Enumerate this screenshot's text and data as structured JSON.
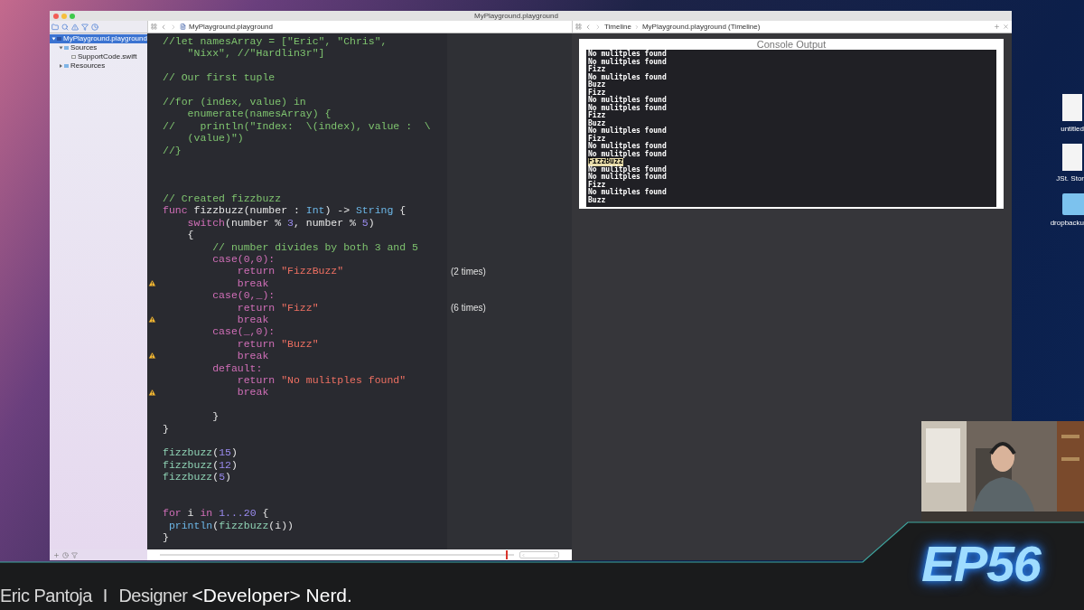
{
  "window": {
    "title": "MyPlayground.playground"
  },
  "navigator": {
    "items": [
      {
        "label": "MyPlayground.playground",
        "selected": true,
        "expanded": true,
        "children": [
          {
            "label": "Sources",
            "selected": false,
            "expanded": true,
            "children": [
              {
                "label": "SupportCode.swift",
                "selected": false
              }
            ]
          },
          {
            "label": "Resources",
            "selected": false,
            "expanded": false
          }
        ]
      }
    ]
  },
  "editor": {
    "jump_bar": "MyPlayground.playground",
    "lines": [
      {
        "warning": false,
        "tokens": [
          {
            "kind": "comment",
            "text": "//let namesArray = [\"Eric\", \"Chris\","
          }
        ]
      },
      {
        "warning": false,
        "tokens": [
          {
            "kind": "comment",
            "text": "    \"Nixx\", //\"Hardlin3r\"]"
          }
        ]
      },
      {
        "warning": false
      },
      {
        "warning": false,
        "tokens": [
          {
            "kind": "comment",
            "text": "// Our first tuple"
          }
        ]
      },
      {
        "warning": false
      },
      {
        "warning": false,
        "tokens": [
          {
            "kind": "comment",
            "text": "//for (index, value) in"
          }
        ]
      },
      {
        "warning": false,
        "tokens": [
          {
            "kind": "comment",
            "text": "    enumerate(namesArray) {"
          }
        ]
      },
      {
        "warning": false,
        "tokens": [
          {
            "kind": "comment",
            "text": "//    println(\"Index:  \\(index), value :  \\"
          }
        ]
      },
      {
        "warning": false,
        "tokens": [
          {
            "kind": "comment",
            "text": "    (value)\")"
          }
        ]
      },
      {
        "warning": false,
        "tokens": [
          {
            "kind": "comment",
            "text": "//}"
          }
        ]
      },
      {
        "warning": false
      },
      {
        "warning": false
      },
      {
        "warning": false
      },
      {
        "warning": false,
        "tokens": [
          {
            "kind": "comment",
            "text": "// Created fizzbuzz"
          }
        ]
      },
      {
        "warning": false,
        "tokens": [
          {
            "kind": "keyword",
            "text": "func"
          },
          {
            "kind": "plain",
            "text": " fizzbuzz(number : "
          },
          {
            "kind": "type",
            "text": "Int"
          },
          {
            "kind": "plain",
            "text": ") -> "
          },
          {
            "kind": "type",
            "text": "String"
          },
          {
            "kind": "plain",
            "text": " {"
          }
        ]
      },
      {
        "warning": false,
        "tokens": [
          {
            "kind": "keyword",
            "text": "    switch"
          },
          {
            "kind": "plain",
            "text": "(number % "
          },
          {
            "kind": "number",
            "text": "3"
          },
          {
            "kind": "plain",
            "text": ", number % "
          },
          {
            "kind": "number",
            "text": "5"
          },
          {
            "kind": "plain",
            "text": ")"
          }
        ]
      },
      {
        "warning": false,
        "tokens": [
          {
            "kind": "plain",
            "text": "    {"
          }
        ]
      },
      {
        "warning": false,
        "tokens": [
          {
            "kind": "comment",
            "text": "        // number divides by both 3 and 5"
          }
        ]
      },
      {
        "warning": false,
        "tokens": [
          {
            "kind": "keyword",
            "text": "        case(0,0):"
          }
        ]
      },
      {
        "warning": false,
        "result": "(2 times)",
        "tokens": [
          {
            "kind": "keyword",
            "text": "            return"
          },
          {
            "kind": "string",
            "text": " \"FizzBuzz\""
          }
        ]
      },
      {
        "warning": true,
        "tokens": [
          {
            "kind": "keyword",
            "text": "            break"
          }
        ]
      },
      {
        "warning": false,
        "tokens": [
          {
            "kind": "keyword",
            "text": "        case(0,_):"
          }
        ]
      },
      {
        "warning": false,
        "result": "(6 times)",
        "tokens": [
          {
            "kind": "keyword",
            "text": "            return"
          },
          {
            "kind": "string",
            "text": " \"Fizz\""
          }
        ]
      },
      {
        "warning": true,
        "tokens": [
          {
            "kind": "keyword",
            "text": "            break"
          }
        ]
      },
      {
        "warning": false,
        "tokens": [
          {
            "kind": "keyword",
            "text": "        case(_,0):"
          }
        ]
      },
      {
        "warning": false,
        "tokens": [
          {
            "kind": "keyword",
            "text": "            return"
          },
          {
            "kind": "string",
            "text": " \"Buzz\""
          }
        ]
      },
      {
        "warning": true,
        "tokens": [
          {
            "kind": "keyword",
            "text": "            break"
          }
        ]
      },
      {
        "warning": false,
        "tokens": [
          {
            "kind": "keyword",
            "text": "        default:"
          }
        ]
      },
      {
        "warning": false,
        "tokens": [
          {
            "kind": "keyword",
            "text": "            return"
          },
          {
            "kind": "string",
            "text": " \"No mulitples found\""
          }
        ]
      },
      {
        "warning": true,
        "tokens": [
          {
            "kind": "keyword",
            "text": "            break"
          }
        ]
      },
      {
        "warning": false
      },
      {
        "warning": false,
        "tokens": [
          {
            "kind": "plain",
            "text": "        }"
          }
        ]
      },
      {
        "warning": false,
        "tokens": [
          {
            "kind": "plain",
            "text": "}"
          }
        ]
      },
      {
        "warning": false
      },
      {
        "warning": false,
        "tokens": [
          {
            "kind": "call",
            "text": "fizzbuzz"
          },
          {
            "kind": "plain",
            "text": "("
          },
          {
            "kind": "number",
            "text": "15"
          },
          {
            "kind": "plain",
            "text": ")"
          }
        ]
      },
      {
        "warning": false,
        "tokens": [
          {
            "kind": "call",
            "text": "fizzbuzz"
          },
          {
            "kind": "plain",
            "text": "("
          },
          {
            "kind": "number",
            "text": "12"
          },
          {
            "kind": "plain",
            "text": ")"
          }
        ]
      },
      {
        "warning": false,
        "tokens": [
          {
            "kind": "call",
            "text": "fizzbuzz"
          },
          {
            "kind": "plain",
            "text": "("
          },
          {
            "kind": "number",
            "text": "5"
          },
          {
            "kind": "plain",
            "text": ")"
          }
        ]
      },
      {
        "warning": false
      },
      {
        "warning": false
      },
      {
        "warning": false,
        "tokens": [
          {
            "kind": "keyword",
            "text": "for"
          },
          {
            "kind": "plain",
            "text": " i "
          },
          {
            "kind": "keyword",
            "text": "in"
          },
          {
            "kind": "number",
            "text": " 1...20"
          },
          {
            "kind": "plain",
            "text": " {"
          }
        ]
      },
      {
        "warning": false,
        "tokens": [
          {
            "kind": "system",
            "text": " println"
          },
          {
            "kind": "plain",
            "text": "("
          },
          {
            "kind": "call",
            "text": "fizzbuzz"
          },
          {
            "kind": "plain",
            "text": "(i))"
          }
        ]
      },
      {
        "warning": false,
        "tokens": [
          {
            "kind": "plain",
            "text": "}"
          }
        ]
      }
    ]
  },
  "assistant": {
    "jump_bar": [
      "Timeline",
      "MyPlayground.playground (Timeline)"
    ],
    "console": {
      "title": "Console Output",
      "lines": [
        {
          "text": "No mulitples found",
          "selected": false
        },
        {
          "text": "No mulitples found",
          "selected": false
        },
        {
          "text": "Fizz",
          "selected": false
        },
        {
          "text": "No mulitples found",
          "selected": false
        },
        {
          "text": "Buzz",
          "selected": false
        },
        {
          "text": "Fizz",
          "selected": false
        },
        {
          "text": "No mulitples found",
          "selected": false
        },
        {
          "text": "No mulitples found",
          "selected": false
        },
        {
          "text": "Fizz",
          "selected": false
        },
        {
          "text": "Buzz",
          "selected": false
        },
        {
          "text": "No mulitples found",
          "selected": false
        },
        {
          "text": "Fizz",
          "selected": false
        },
        {
          "text": "No mulitples found",
          "selected": false
        },
        {
          "text": "No mulitples found",
          "selected": false
        },
        {
          "text": "FizzBuzz",
          "selected": true
        },
        {
          "text": "No mulitples found",
          "selected": false
        },
        {
          "text": "No mulitples found",
          "selected": false
        },
        {
          "text": "Fizz",
          "selected": false
        },
        {
          "text": "No mulitples found",
          "selected": false
        },
        {
          "text": "Buzz",
          "selected": false
        }
      ]
    }
  },
  "timeline": {
    "level": 0.98
  },
  "desktop_icons": [
    {
      "label": "untitled",
      "kind": "document"
    },
    {
      "label": "JSt. Stor",
      "kind": "document"
    },
    {
      "label": "dropbacku",
      "kind": "folder"
    }
  ],
  "banner": {
    "name": "Eric Pantoja",
    "separator": "I",
    "role": "Designer",
    "tagline": "<Developer> Nerd.",
    "logo": "EP56"
  }
}
